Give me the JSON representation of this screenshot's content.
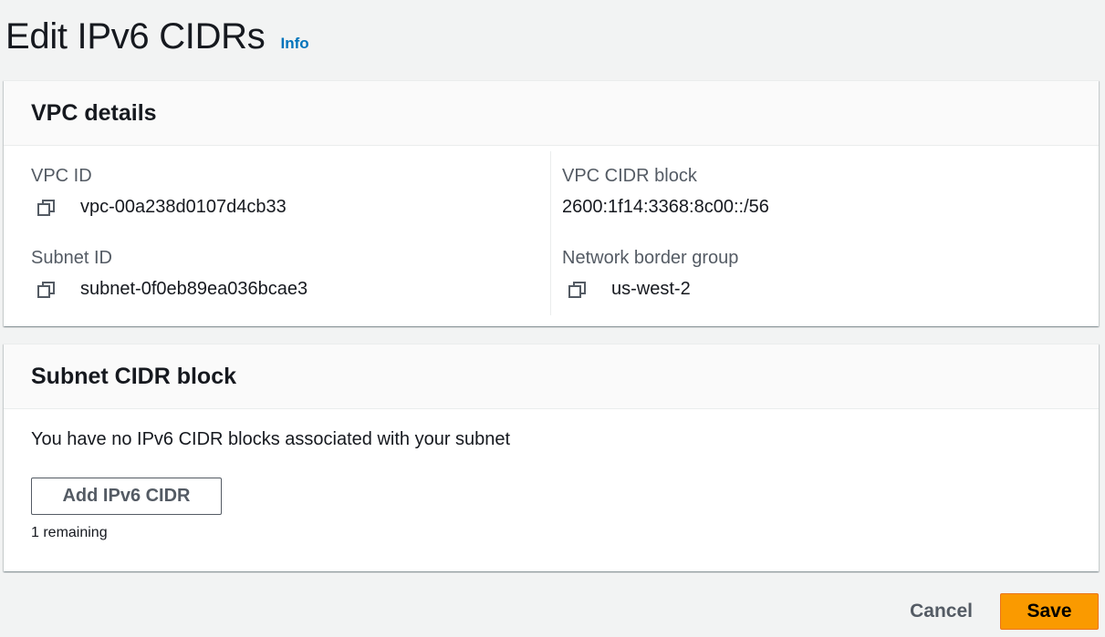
{
  "page": {
    "title": "Edit IPv6 CIDRs",
    "info_link": "Info"
  },
  "vpc_details": {
    "heading": "VPC details",
    "vpc_id_label": "VPC ID",
    "vpc_id_value": "vpc-00a238d0107d4cb33",
    "subnet_id_label": "Subnet ID",
    "subnet_id_value": "subnet-0f0eb89ea036bcae3",
    "vpc_cidr_label": "VPC CIDR block",
    "vpc_cidr_value": "2600:1f14:3368:8c00::/56",
    "border_group_label": "Network border group",
    "border_group_value": "us-west-2",
    "copy_icon": "copy-icon"
  },
  "subnet_cidr": {
    "heading": "Subnet CIDR block",
    "empty_message": "You have no IPv6 CIDR blocks associated with your subnet",
    "add_button": "Add IPv6 CIDR",
    "remaining": "1 remaining"
  },
  "footer": {
    "cancel_label": "Cancel",
    "save_label": "Save"
  },
  "colors": {
    "background": "#f2f3f3",
    "link": "#0073bb",
    "primary_button": "#fa9a00",
    "secondary_text": "#545b64"
  }
}
